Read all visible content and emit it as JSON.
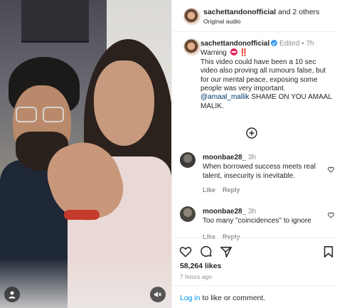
{
  "post": {
    "author": "sachettandonofficial",
    "collaborators_text": "and 2 others",
    "audio": "Original audio"
  },
  "caption": {
    "username": "sachettandonofficial",
    "edited": "Edited",
    "separator": "•",
    "time": "7h",
    "warning_word": "Warning",
    "warning_marks": "‼️",
    "body": "This video could have been a 10 sec video also proving all rumours false, but for our mental peace, exposing some people was very important.",
    "mention": "@amaal_mallik",
    "shame": "SHAME ON YOU AMAAL MALIK."
  },
  "comments": [
    {
      "username": "moonbae28_",
      "time": "3h",
      "text": "When borrowed success meets real talent, insecurity is inevitable.",
      "like_label": "Like",
      "reply_label": "Reply"
    },
    {
      "username": "moonbae28_",
      "time": "3h",
      "text": "Too many \"coincidences\" to ignore",
      "like_label": "Like",
      "reply_label": "Reply"
    }
  ],
  "stats": {
    "likes": "58,264 likes",
    "posted": "7 hours ago"
  },
  "login": {
    "link_text": "Log in",
    "rest_text": " to like or comment."
  },
  "icons": {
    "more": "plus-circle-icon",
    "like": "heart-icon",
    "comment": "comment-bubble-icon",
    "share": "paper-plane-icon",
    "save": "bookmark-icon",
    "user_tag": "user-icon",
    "mute": "speaker-muted-icon"
  },
  "colors": {
    "link": "#0095f6",
    "mention": "#00376b",
    "verified": "#3897f0",
    "warning": "#e0245e",
    "muted_text": "#8e8e8e"
  }
}
